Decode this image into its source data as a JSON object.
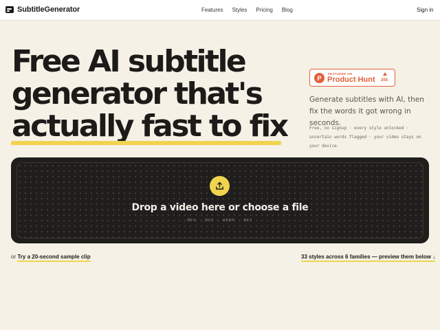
{
  "header": {
    "brand": "SubtitleGenerator",
    "nav": [
      "Features",
      "Styles",
      "Pricing",
      "Blog"
    ],
    "signin": "Sign in"
  },
  "hero": {
    "title_lines": [
      "Free AI subtitle",
      "generator that's",
      "actually fast to fix"
    ],
    "subtitle": "Generate subtitles with AI, then fix the words it got wrong in seconds.",
    "features": "Free, no signup · every style unlocked · uncertain words flagged · your video stays on your device."
  },
  "product_hunt": {
    "featured": "FEATURED ON",
    "name": "Product Hunt",
    "letter": "P",
    "count": "205"
  },
  "dropzone": {
    "title": "Drop a video here or choose a file",
    "formats": "MP4 · MOV · WEBM · MKV"
  },
  "links": {
    "prefix": "or",
    "sample": "Try a 20-second sample clip",
    "styles": "33 styles across 6 families — preview them below ↓"
  },
  "colors": {
    "accent_yellow": "#f0d44e",
    "product_hunt": "#e3603d",
    "dark": "#1f1e1c",
    "background": "#f5f1e6"
  }
}
